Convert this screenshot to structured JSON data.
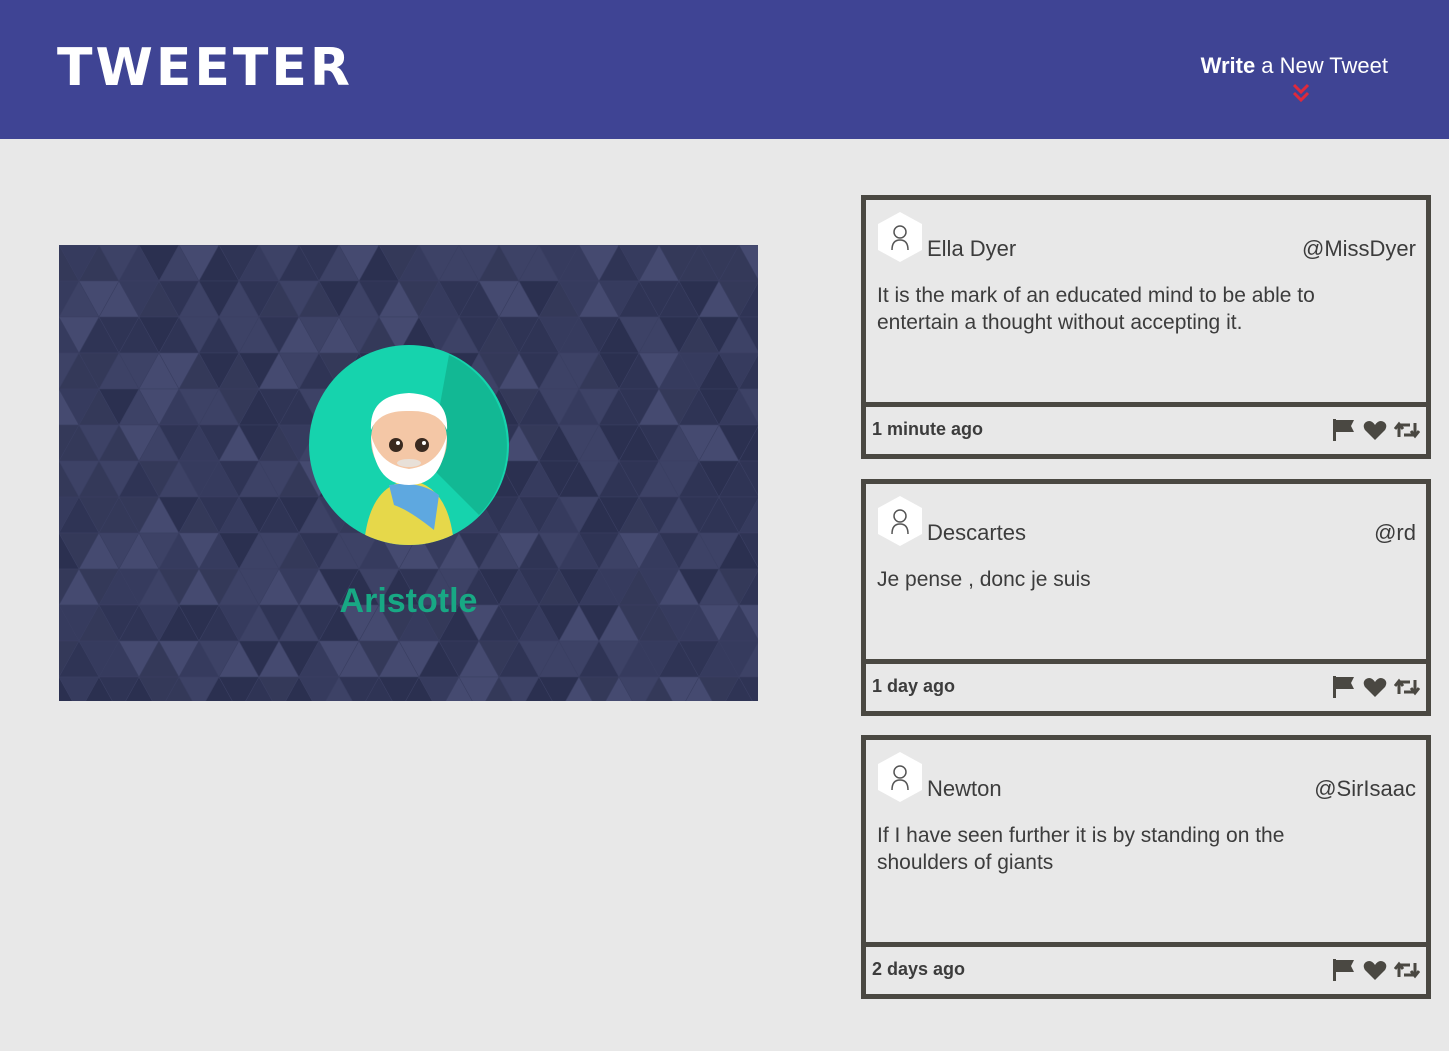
{
  "header": {
    "logo": "TWEETER",
    "compose_bold": "Write",
    "compose_rest": "a New Tweet",
    "accent_color": "#e0293b",
    "bg_color": "#3f4494"
  },
  "profile": {
    "name": "Aristotle",
    "avatar_icon": "aristotle-avatar-icon"
  },
  "tweets": [
    {
      "name": "Ella Dyer",
      "handle": "@MissDyer",
      "text": "It is the mark of an educated mind to be able to entertain a thought without accepting it.",
      "time": "1 minute ago"
    },
    {
      "name": "Descartes",
      "handle": "@rd",
      "text": "Je pense , donc je suis",
      "time": "1 day ago"
    },
    {
      "name": "Newton",
      "handle": "@SirIsaac",
      "text": "If I have seen further it is by standing on the shoulders of giants",
      "time": "2 days ago"
    }
  ],
  "icons": [
    "flag-icon",
    "heart-icon",
    "retweet-icon"
  ]
}
